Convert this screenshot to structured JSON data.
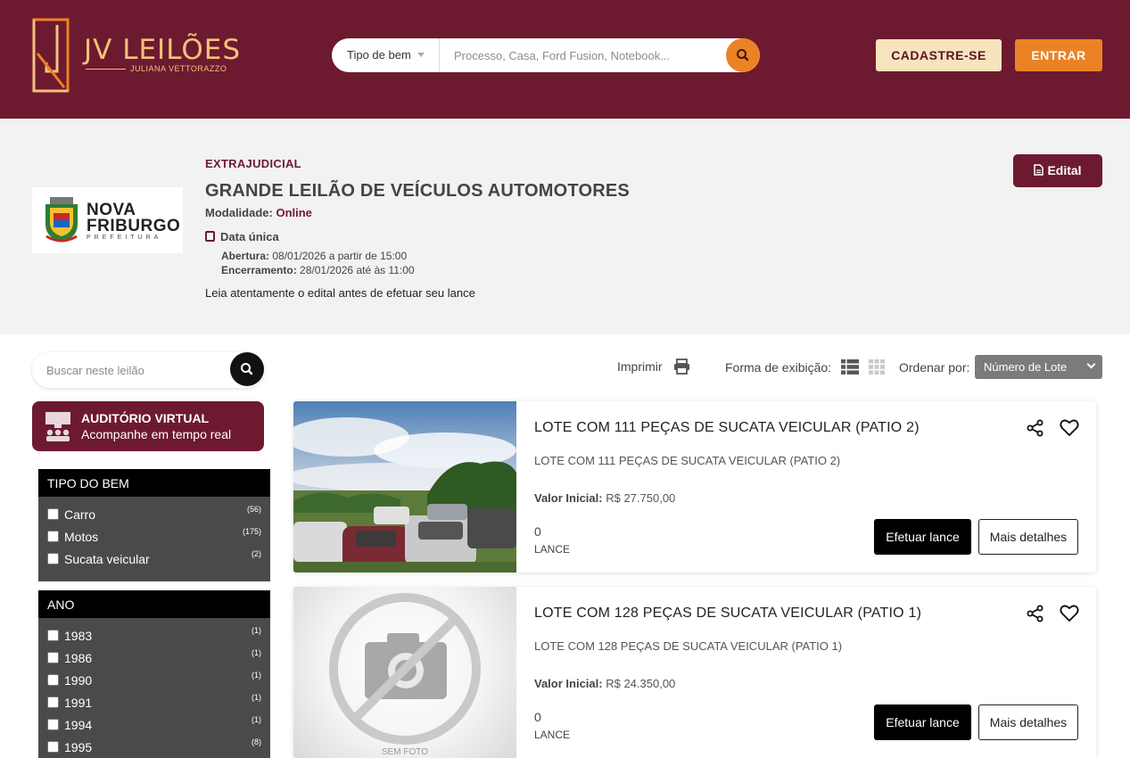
{
  "header": {
    "logo_title": "JV LEILÕES",
    "logo_subtitle": "JULIANA VETTORAZZO",
    "search_type_label": "Tipo de bem",
    "search_placeholder": "Processo, Casa, Ford Fusion, Notebook...",
    "register_label": "CADASTRE-SE",
    "login_label": "ENTRAR"
  },
  "auction": {
    "org_name_line1": "NOVA",
    "org_name_line2": "FRIBURGO",
    "org_name_line3": "PREFEITURA",
    "type": "EXTRAJUDICIAL",
    "title": "GRANDE LEILÃO DE VEÍCULOS AUTOMOTORES",
    "modality_label": "Modalidade:",
    "modality_value": "Online",
    "date_label": "Data única",
    "opening_label": "Abertura:",
    "opening_value": "08/01/2026 a partir de 15:00",
    "closing_label": "Encerramento:",
    "closing_value": "28/01/2026 até às 11:00",
    "note": "Leia atentamente o edital antes de efetuar seu lance",
    "edital_label": "Edital"
  },
  "sidebar": {
    "search_placeholder": "Buscar neste leilão",
    "virtual_title": "AUDITÓRIO VIRTUAL",
    "virtual_subtitle": "Acompanhe em tempo real",
    "filters": [
      {
        "title": "TIPO DO BEM",
        "items": [
          {
            "label": "Carro",
            "count": "(56)"
          },
          {
            "label": "Motos",
            "count": "(175)"
          },
          {
            "label": "Sucata veicular",
            "count": "(2)"
          }
        ]
      },
      {
        "title": "ANO",
        "items": [
          {
            "label": "1983",
            "count": "(1)"
          },
          {
            "label": "1986",
            "count": "(1)"
          },
          {
            "label": "1990",
            "count": "(1)"
          },
          {
            "label": "1991",
            "count": "(1)"
          },
          {
            "label": "1994",
            "count": "(1)"
          },
          {
            "label": "1995",
            "count": "(8)"
          }
        ]
      }
    ]
  },
  "toolbar": {
    "print_label": "Imprimir",
    "view_label": "Forma de exibição:",
    "order_label": "Ordenar por:",
    "order_value": "Número de Lote"
  },
  "lots": [
    {
      "title": "LOTE COM 111 PEÇAS DE SUCATA VEICULAR (PATIO 2)",
      "description": "LOTE COM 111 PEÇAS DE SUCATA VEICULAR (PATIO 2)",
      "value_label": "Valor Inicial:",
      "value": "R$ 27.750,00",
      "bids": "0",
      "bids_label": "LANCE",
      "bid_button": "Efetuar lance",
      "details_button": "Mais detalhes"
    },
    {
      "title": "LOTE COM 128 PEÇAS DE SUCATA VEICULAR (PATIO 1)",
      "description": "LOTE COM 128 PEÇAS DE SUCATA VEICULAR (PATIO 1)",
      "value_label": "Valor Inicial:",
      "value": "R$ 24.350,00",
      "bids": "0",
      "bids_label": "LANCE",
      "bid_button": "Efetuar lance",
      "details_button": "Mais detalhes",
      "no_photo_label": "SEM FOTO"
    }
  ],
  "colors": {
    "brand": "#6d1a30",
    "accent": "#ec8226",
    "logo_gold": "#f3c27a"
  }
}
